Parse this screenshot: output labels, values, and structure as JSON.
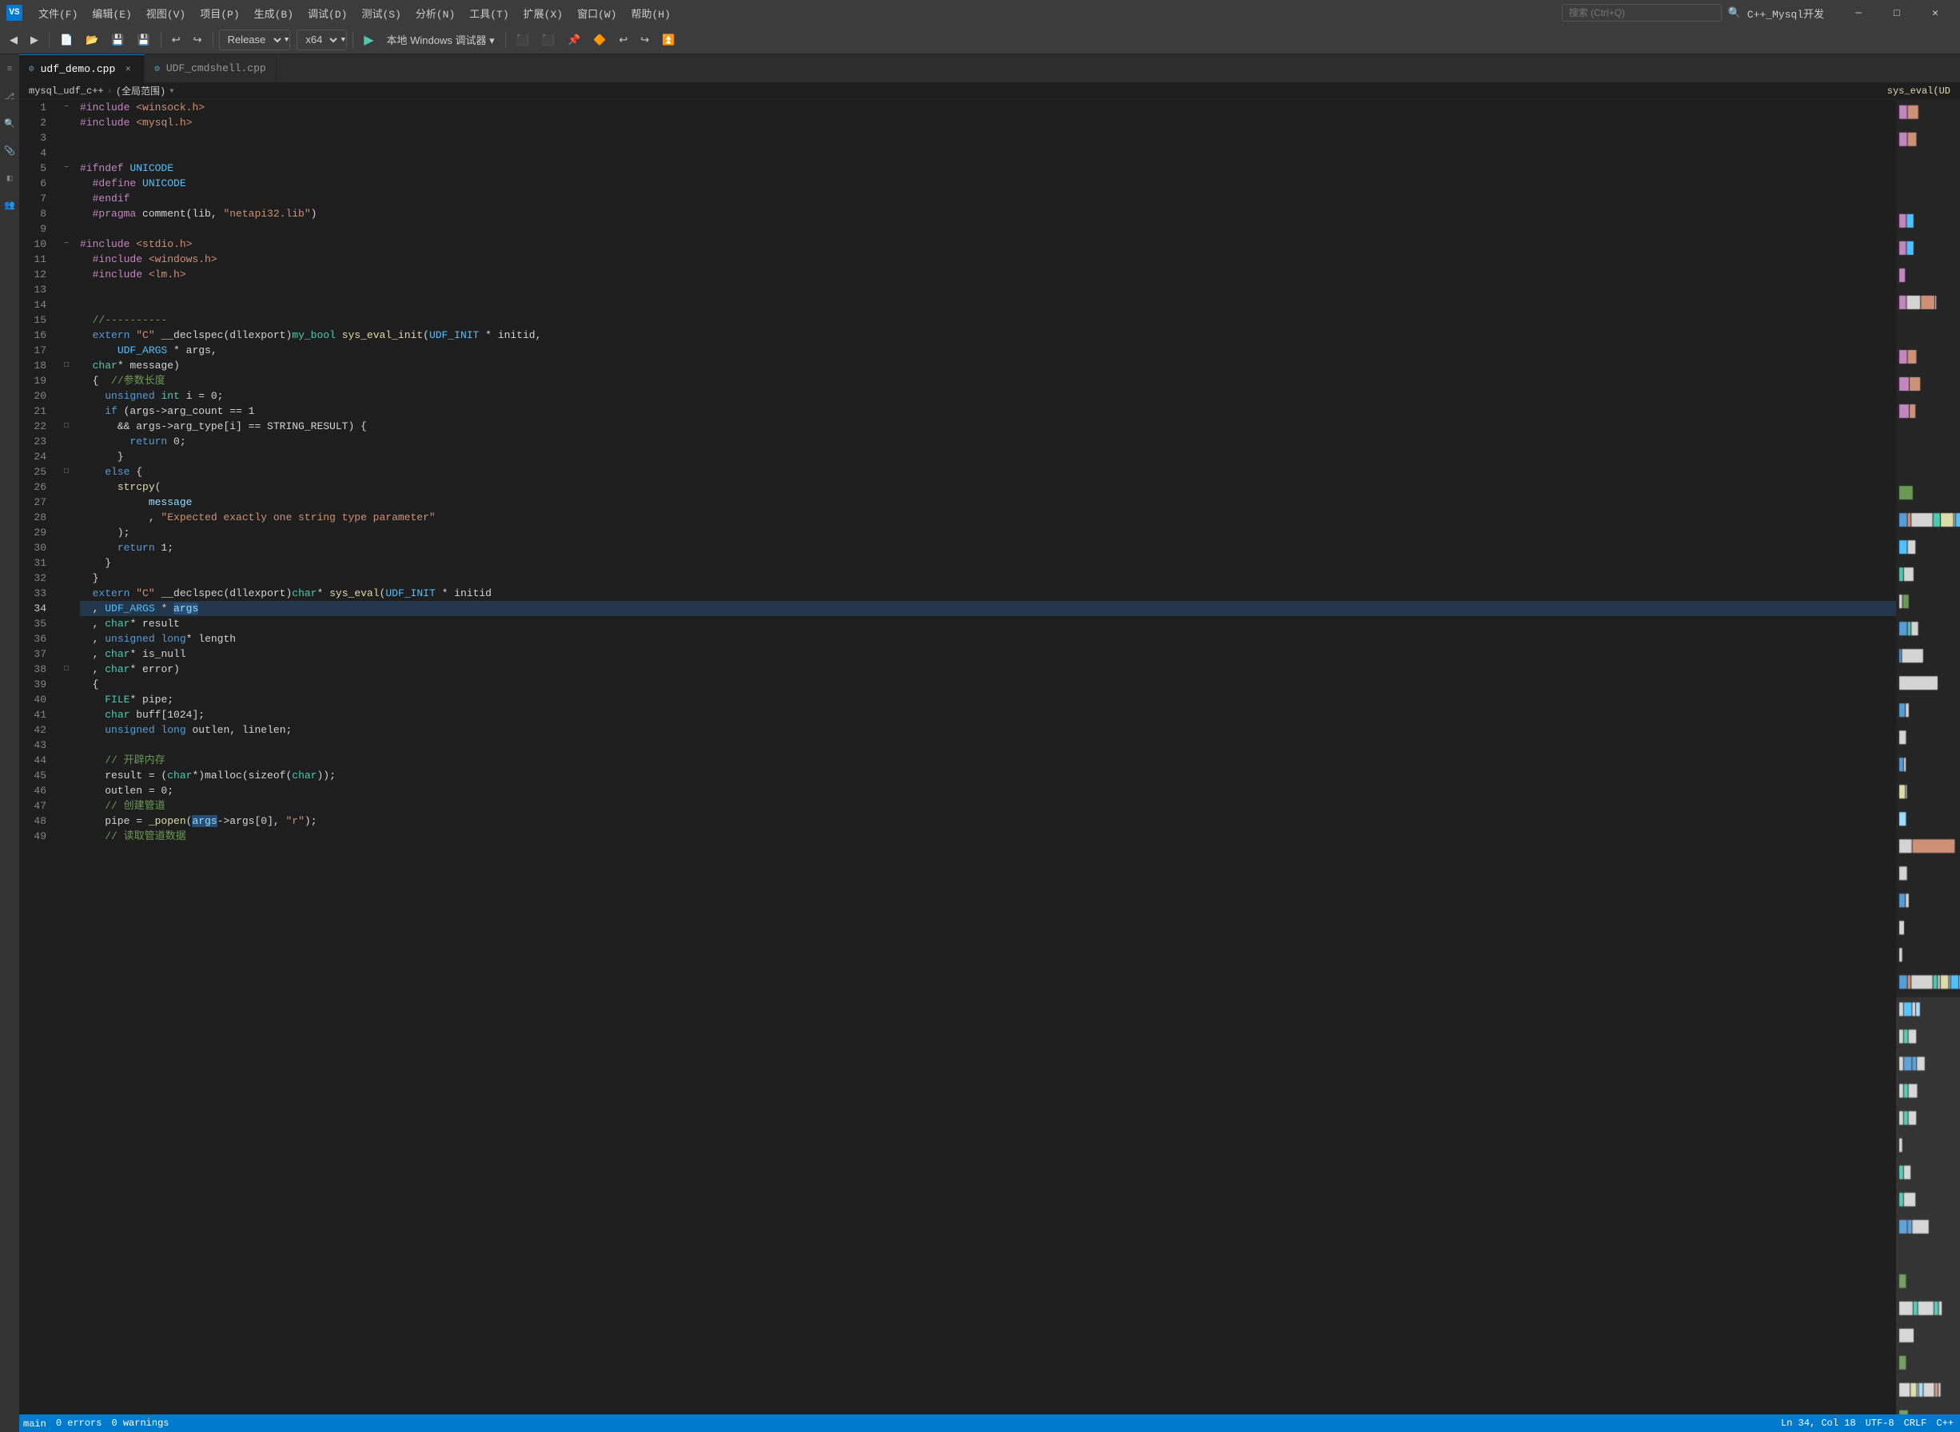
{
  "titlebar": {
    "app_icon": "VS",
    "menus": [
      "文件(F)",
      "编辑(E)",
      "视图(V)",
      "项目(P)",
      "生成(B)",
      "调试(D)",
      "测试(S)",
      "分析(N)",
      "工具(T)",
      "扩展(X)",
      "窗口(W)",
      "帮助(H)"
    ],
    "search_placeholder": "搜索 (Ctrl+Q)",
    "profile": "C++_Mysql开发"
  },
  "toolbar": {
    "back_label": "◀",
    "forward_label": "▶",
    "config_dropdown": "Release",
    "platform_dropdown": "x64",
    "play_label": "▶",
    "play_text": "本地 Windows 调试器",
    "debug_icons": [
      "🔲",
      "⬛",
      "📌",
      "🔶",
      "↩",
      "↪",
      "⏫"
    ]
  },
  "tabs": [
    {
      "label": "udf_demo.cpp",
      "active": true,
      "closeable": true
    },
    {
      "label": "UDF_cmdshell.cpp",
      "active": false,
      "closeable": false
    }
  ],
  "breadcrumb": {
    "project": "mysql_udf_c++",
    "scope_label": "(全局范围)",
    "func_label": "sys_eval(UD"
  },
  "editor": {
    "lines": [
      {
        "num": 1,
        "fold": "#",
        "tokens": [
          {
            "t": "pp",
            "v": "#include"
          },
          {
            "t": "op",
            "v": " "
          },
          {
            "t": "inc",
            "v": "<winsock.h>"
          }
        ]
      },
      {
        "num": 2,
        "fold": " ",
        "tokens": [
          {
            "t": "pp",
            "v": "#include"
          },
          {
            "t": "op",
            "v": " "
          },
          {
            "t": "inc",
            "v": "<mysql.h>"
          }
        ]
      },
      {
        "num": 3,
        "fold": " ",
        "tokens": []
      },
      {
        "num": 4,
        "fold": " ",
        "tokens": []
      },
      {
        "num": 5,
        "fold": "#",
        "tokens": [
          {
            "t": "pp",
            "v": "#ifndef"
          },
          {
            "t": "op",
            "v": " "
          },
          {
            "t": "mac",
            "v": "UNICODE"
          }
        ]
      },
      {
        "num": 6,
        "fold": " ",
        "tokens": [
          {
            "t": "op",
            "v": "  "
          },
          {
            "t": "pp",
            "v": "#define"
          },
          {
            "t": "op",
            "v": " "
          },
          {
            "t": "mac",
            "v": "UNICODE"
          }
        ]
      },
      {
        "num": 7,
        "fold": " ",
        "tokens": [
          {
            "t": "op",
            "v": "  "
          },
          {
            "t": "pp",
            "v": "#endif"
          }
        ]
      },
      {
        "num": 8,
        "fold": " ",
        "tokens": [
          {
            "t": "op",
            "v": "  "
          },
          {
            "t": "pp",
            "v": "#pragma"
          },
          {
            "t": "op",
            "v": " comment(lib, "
          },
          {
            "t": "str",
            "v": "\"netapi32.lib\""
          },
          {
            "t": "op",
            "v": ")"
          }
        ]
      },
      {
        "num": 9,
        "fold": " ",
        "tokens": []
      },
      {
        "num": 10,
        "fold": "#",
        "tokens": [
          {
            "t": "pp",
            "v": "#include"
          },
          {
            "t": "op",
            "v": " "
          },
          {
            "t": "inc",
            "v": "<stdio.h>"
          }
        ]
      },
      {
        "num": 11,
        "fold": " ",
        "tokens": [
          {
            "t": "pp",
            "v": "  #include"
          },
          {
            "t": "op",
            "v": " "
          },
          {
            "t": "inc",
            "v": "<windows.h>"
          }
        ]
      },
      {
        "num": 12,
        "fold": " ",
        "tokens": [
          {
            "t": "pp",
            "v": "  #include"
          },
          {
            "t": "op",
            "v": " "
          },
          {
            "t": "inc",
            "v": "<lm.h>"
          }
        ]
      },
      {
        "num": 13,
        "fold": " ",
        "tokens": []
      },
      {
        "num": 14,
        "fold": " ",
        "tokens": []
      },
      {
        "num": 15,
        "fold": " ",
        "tokens": [
          {
            "t": "cm",
            "v": "  //----------"
          }
        ]
      },
      {
        "num": 16,
        "fold": " ",
        "tokens": [
          {
            "t": "kw",
            "v": "  extern"
          },
          {
            "t": "op",
            "v": " "
          },
          {
            "t": "str",
            "v": "\"C\""
          },
          {
            "t": "op",
            "v": " __declspec(dllexport)"
          },
          {
            "t": "type",
            "v": "my_bool"
          },
          {
            "t": "op",
            "v": " "
          },
          {
            "t": "fn",
            "v": "sys_eval_init"
          },
          {
            "t": "op",
            "v": "("
          },
          {
            "t": "mac",
            "v": "UDF_INIT"
          },
          {
            "t": "op",
            "v": " * initid,"
          }
        ]
      },
      {
        "num": 17,
        "fold": " ",
        "tokens": [
          {
            "t": "op",
            "v": "      "
          },
          {
            "t": "mac",
            "v": "UDF_ARGS"
          },
          {
            "t": "op",
            "v": " * args,"
          }
        ]
      },
      {
        "num": 18,
        "fold": "□",
        "tokens": [
          {
            "t": "op",
            "v": "  "
          },
          {
            "t": "type",
            "v": "char"
          },
          {
            "t": "op",
            "v": "* message)"
          }
        ]
      },
      {
        "num": 19,
        "fold": " ",
        "tokens": [
          {
            "t": "op",
            "v": "  {"
          },
          {
            "t": "op",
            "v": "  "
          },
          {
            "t": "cm",
            "v": "//参数长度"
          }
        ]
      },
      {
        "num": 20,
        "fold": " ",
        "tokens": [
          {
            "t": "op",
            "v": "    "
          },
          {
            "t": "kw",
            "v": "unsigned"
          },
          {
            "t": "op",
            "v": " "
          },
          {
            "t": "type",
            "v": "int"
          },
          {
            "t": "op",
            "v": " i = 0;"
          }
        ]
      },
      {
        "num": 21,
        "fold": " ",
        "tokens": [
          {
            "t": "op",
            "v": "    "
          },
          {
            "t": "kw",
            "v": "if"
          },
          {
            "t": "op",
            "v": " (args->arg_count == 1"
          }
        ]
      },
      {
        "num": 22,
        "fold": "□",
        "tokens": [
          {
            "t": "op",
            "v": "      "
          },
          {
            "t": "op",
            "v": "&& args->arg_type[i] == STRING_RESULT) {"
          }
        ]
      },
      {
        "num": 23,
        "fold": " ",
        "tokens": [
          {
            "t": "op",
            "v": "        "
          },
          {
            "t": "kw",
            "v": "return"
          },
          {
            "t": "op",
            "v": " 0;"
          }
        ]
      },
      {
        "num": 24,
        "fold": " ",
        "tokens": [
          {
            "t": "op",
            "v": "      }"
          }
        ]
      },
      {
        "num": 25,
        "fold": "□",
        "tokens": [
          {
            "t": "op",
            "v": "    "
          },
          {
            "t": "kw",
            "v": "else"
          },
          {
            "t": "op",
            "v": " {"
          }
        ]
      },
      {
        "num": 26,
        "fold": " ",
        "tokens": [
          {
            "t": "op",
            "v": "      "
          },
          {
            "t": "fn",
            "v": "strcpy"
          },
          {
            "t": "op",
            "v": "("
          }
        ]
      },
      {
        "num": 27,
        "fold": " ",
        "tokens": [
          {
            "t": "op",
            "v": "           "
          },
          {
            "t": "var",
            "v": "message"
          }
        ]
      },
      {
        "num": 28,
        "fold": " ",
        "tokens": [
          {
            "t": "op",
            "v": "           , "
          },
          {
            "t": "str",
            "v": "\"Expected exactly one string type parameter\""
          }
        ]
      },
      {
        "num": 29,
        "fold": " ",
        "tokens": [
          {
            "t": "op",
            "v": "      );"
          }
        ]
      },
      {
        "num": 30,
        "fold": " ",
        "tokens": [
          {
            "t": "op",
            "v": "      "
          },
          {
            "t": "kw",
            "v": "return"
          },
          {
            "t": "op",
            "v": " 1;"
          }
        ]
      },
      {
        "num": 31,
        "fold": " ",
        "tokens": [
          {
            "t": "op",
            "v": "    }"
          }
        ]
      },
      {
        "num": 32,
        "fold": " ",
        "tokens": [
          {
            "t": "op",
            "v": "  }"
          }
        ]
      },
      {
        "num": 33,
        "fold": " ",
        "tokens": [
          {
            "t": "kw",
            "v": "  extern"
          },
          {
            "t": "op",
            "v": " "
          },
          {
            "t": "str",
            "v": "\"C\""
          },
          {
            "t": "op",
            "v": " __declspec(dllexport)"
          },
          {
            "t": "type",
            "v": "char"
          },
          {
            "t": "op",
            "v": "* "
          },
          {
            "t": "fn",
            "v": "sys_eval"
          },
          {
            "t": "op",
            "v": "("
          },
          {
            "t": "mac",
            "v": "UDF_INIT"
          },
          {
            "t": "op",
            "v": " * initid"
          }
        ]
      },
      {
        "num": 34,
        "fold": " ",
        "tokens": [
          {
            "t": "op",
            "v": "  , "
          },
          {
            "t": "mac",
            "v": "UDF_ARGS"
          },
          {
            "t": "op",
            "v": " * "
          },
          {
            "t": "var_hl",
            "v": "args"
          }
        ],
        "selected": true
      },
      {
        "num": 35,
        "fold": " ",
        "tokens": [
          {
            "t": "op",
            "v": "  , "
          },
          {
            "t": "type",
            "v": "char"
          },
          {
            "t": "op",
            "v": "* result"
          }
        ]
      },
      {
        "num": 36,
        "fold": " ",
        "tokens": [
          {
            "t": "op",
            "v": "  , "
          },
          {
            "t": "kw",
            "v": "unsigned"
          },
          {
            "t": "op",
            "v": " "
          },
          {
            "t": "kw",
            "v": "long"
          },
          {
            "t": "op",
            "v": "* length"
          }
        ]
      },
      {
        "num": 37,
        "fold": " ",
        "tokens": [
          {
            "t": "op",
            "v": "  , "
          },
          {
            "t": "type",
            "v": "char"
          },
          {
            "t": "op",
            "v": "* is_null"
          }
        ]
      },
      {
        "num": 38,
        "fold": "□",
        "tokens": [
          {
            "t": "op",
            "v": "  , "
          },
          {
            "t": "type",
            "v": "char"
          },
          {
            "t": "op",
            "v": "* error)"
          }
        ]
      },
      {
        "num": 39,
        "fold": " ",
        "tokens": [
          {
            "t": "op",
            "v": "  {"
          }
        ]
      },
      {
        "num": 40,
        "fold": " ",
        "tokens": [
          {
            "t": "op",
            "v": "    "
          },
          {
            "t": "type",
            "v": "FILE"
          },
          {
            "t": "op",
            "v": "* pipe;"
          }
        ]
      },
      {
        "num": 41,
        "fold": " ",
        "tokens": [
          {
            "t": "op",
            "v": "    "
          },
          {
            "t": "type",
            "v": "char"
          },
          {
            "t": "op",
            "v": " buff[1024];"
          }
        ]
      },
      {
        "num": 42,
        "fold": " ",
        "tokens": [
          {
            "t": "op",
            "v": "    "
          },
          {
            "t": "kw",
            "v": "unsigned"
          },
          {
            "t": "op",
            "v": " "
          },
          {
            "t": "kw",
            "v": "long"
          },
          {
            "t": "op",
            "v": " outlen, linelen;"
          }
        ]
      },
      {
        "num": 43,
        "fold": " ",
        "tokens": []
      },
      {
        "num": 44,
        "fold": " ",
        "tokens": [
          {
            "t": "op",
            "v": "    "
          },
          {
            "t": "cm",
            "v": "// 开辟内存"
          }
        ]
      },
      {
        "num": 45,
        "fold": " ",
        "tokens": [
          {
            "t": "op",
            "v": "    result = ("
          },
          {
            "t": "type",
            "v": "char"
          },
          {
            "t": "op",
            "v": "*)malloc(sizeof("
          },
          {
            "t": "type",
            "v": "char"
          },
          {
            "t": "op",
            "v": "));"
          }
        ]
      },
      {
        "num": 46,
        "fold": " ",
        "tokens": [
          {
            "t": "op",
            "v": "    outlen = 0;"
          }
        ]
      },
      {
        "num": 47,
        "fold": " ",
        "tokens": [
          {
            "t": "op",
            "v": "    "
          },
          {
            "t": "cm",
            "v": "// 创建管道"
          }
        ]
      },
      {
        "num": 48,
        "fold": " ",
        "tokens": [
          {
            "t": "op",
            "v": "    pipe = "
          },
          {
            "t": "fn",
            "v": "_popen"
          },
          {
            "t": "op",
            "v": "("
          },
          {
            "t": "var_hl2",
            "v": "args"
          },
          {
            "t": "op",
            "v": "->args[0], "
          },
          {
            "t": "str",
            "v": "\"r\""
          },
          {
            "t": "op",
            "v": ");"
          }
        ]
      },
      {
        "num": 49,
        "fold": " ",
        "tokens": [
          {
            "t": "op",
            "v": "    "
          },
          {
            "t": "cm",
            "v": "// 读取管道数据"
          }
        ]
      }
    ]
  },
  "statusbar": {
    "branch": "main",
    "errors": "0 errors",
    "warnings": "0 warnings",
    "encoding": "UTF-8",
    "line_ending": "CRLF",
    "language": "C++",
    "line": "34",
    "col": "18"
  }
}
